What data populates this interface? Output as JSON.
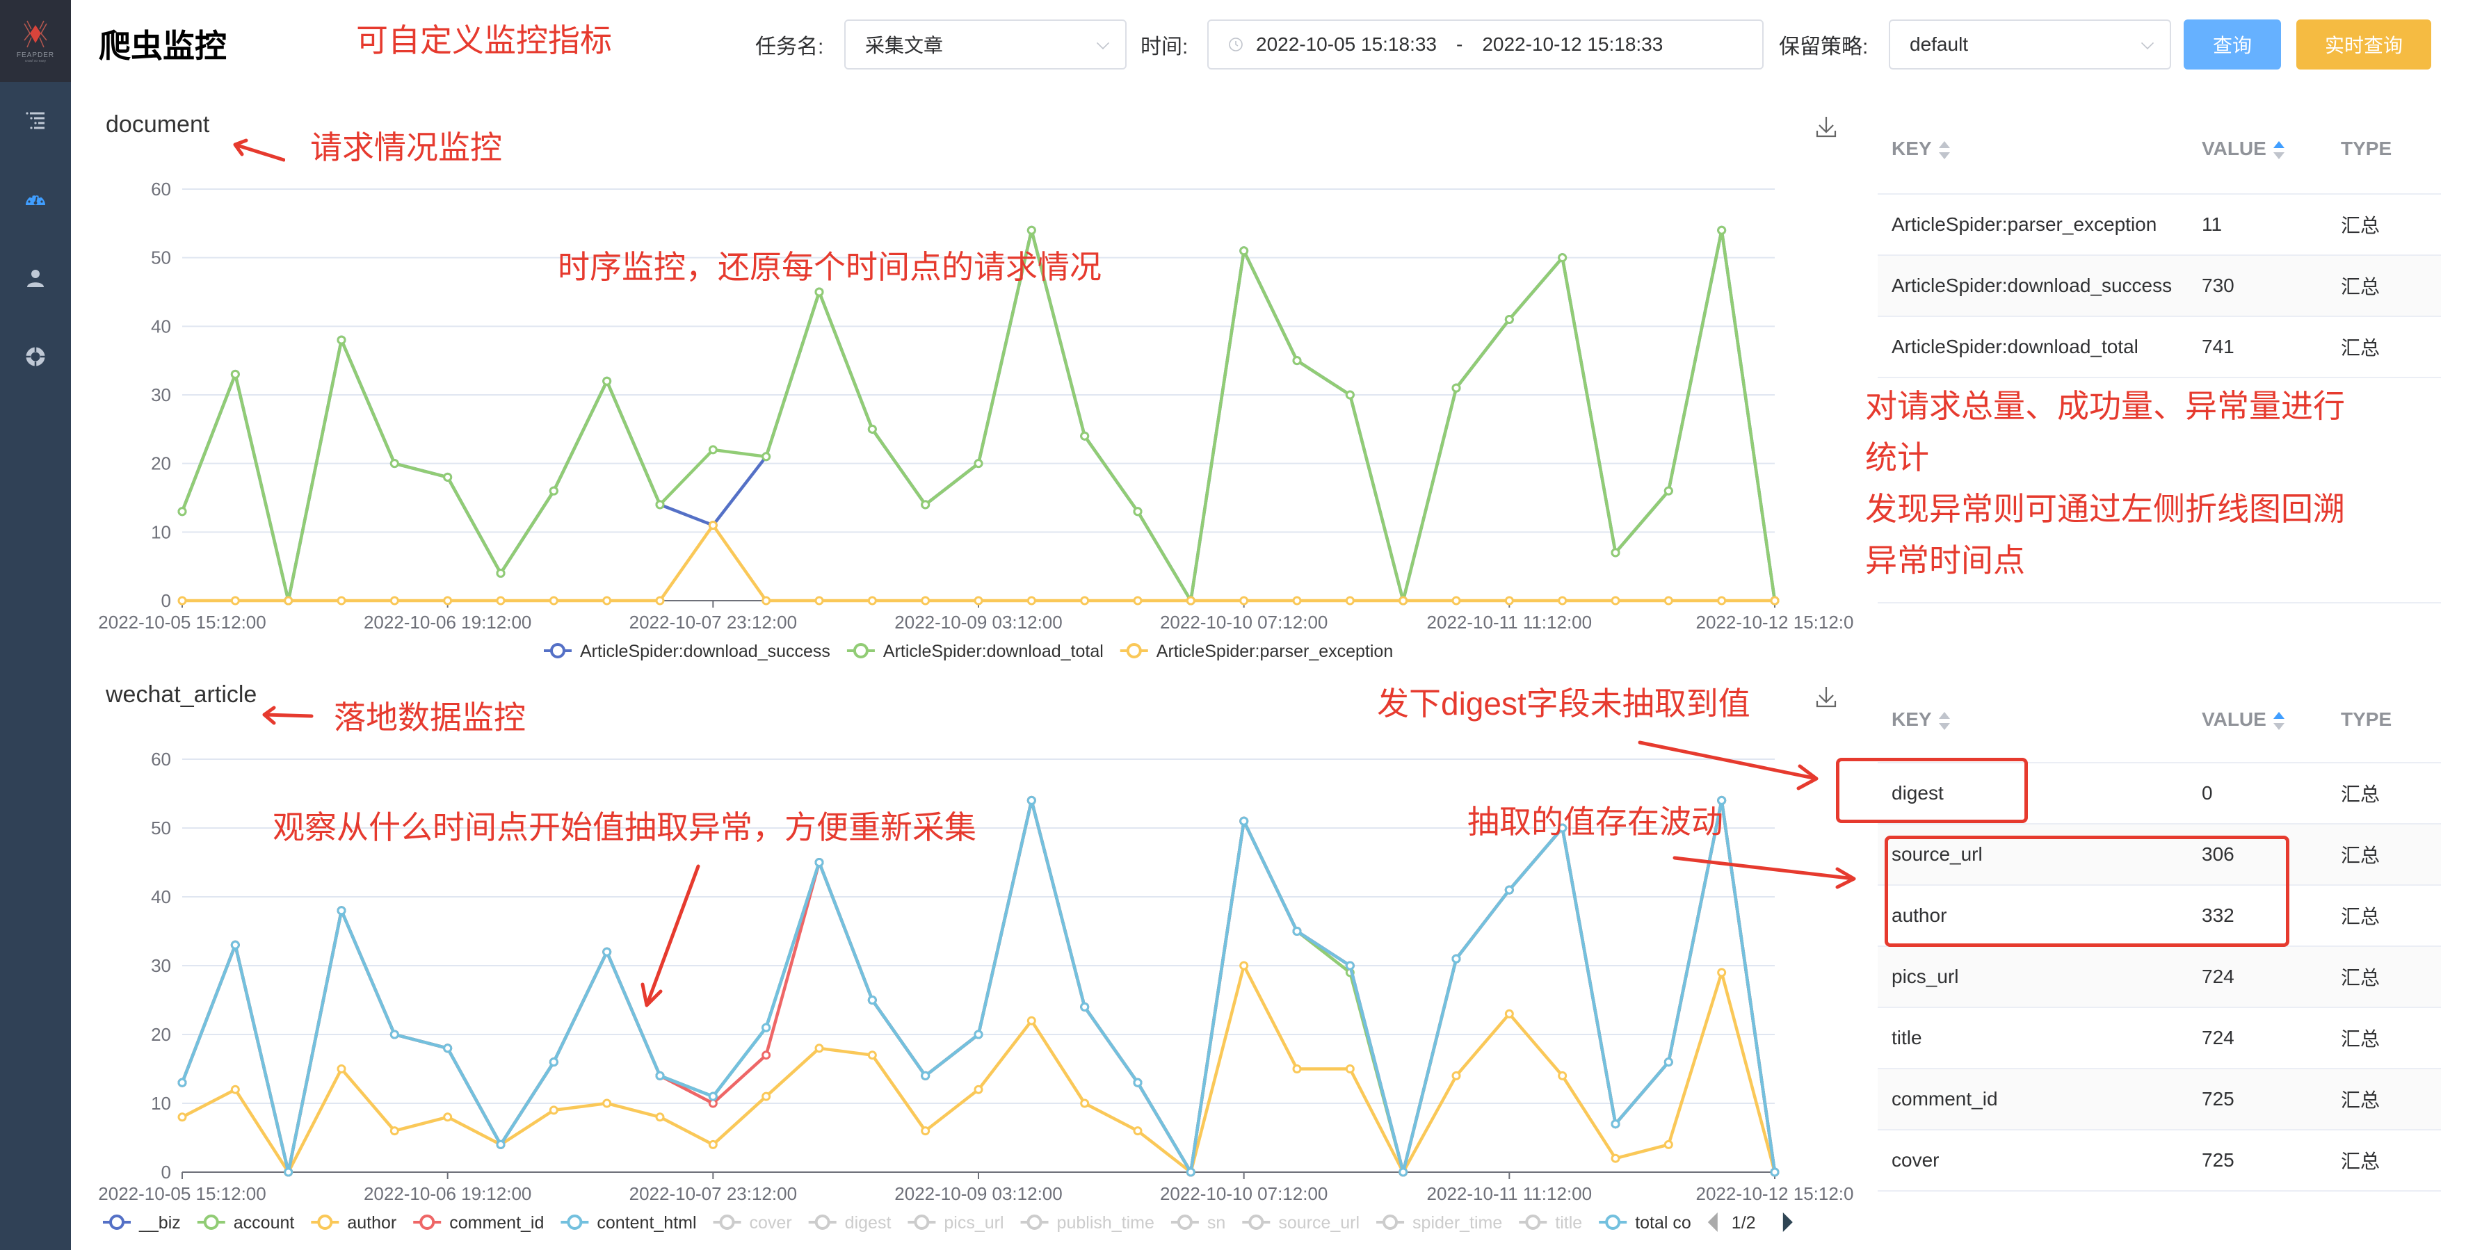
{
  "app": {
    "title": "爬虫监控",
    "logo_text": "FEAPDER",
    "logo_sub": "crawl so easy"
  },
  "sidebar": {
    "items": [
      {
        "icon": "list-tree-icon",
        "active": false
      },
      {
        "icon": "dashboard-gauge-icon",
        "active": true
      },
      {
        "icon": "user-icon",
        "active": false
      },
      {
        "icon": "lifebuoy-icon",
        "active": false
      }
    ]
  },
  "filters": {
    "task_label": "任务名:",
    "task_value": "采集文章",
    "time_label": "时间:",
    "time_start": "2022-10-05 15:18:33",
    "time_sep": "-",
    "time_end": "2022-10-12 15:18:33",
    "retention_label": "保留策略:",
    "retention_value": "default",
    "query_button": "查询",
    "realtime_button": "实时查询"
  },
  "colors": {
    "primary_button": "#66b1ff",
    "realtime_button": "#f5bb42",
    "annotation": "#e63a2e"
  },
  "annotations": {
    "custom_metrics": "可自定义监控指标",
    "request_monitor": "请求情况监控",
    "timeseries": "时序监控，还原每个时间点的请求情况",
    "stats_line1": "对请求总量、成功量、异常量进行",
    "stats_line2": "统计",
    "stats_line3": "发现异常则可通过左侧折线图回溯",
    "stats_line4": "异常时间点",
    "landing_monitor": "落地数据监控",
    "digest_missing": "发下digest字段未抽取到值",
    "observe": "观察从什么时间点开始值抽取异常，方便重新采集",
    "fluctuation": "抽取的值存在波动"
  },
  "tables": [
    {
      "headers": {
        "key": "KEY",
        "value": "VALUE",
        "type": "TYPE"
      },
      "rows": [
        {
          "key": "ArticleSpider:parser_exception",
          "value": "11",
          "type": "汇总"
        },
        {
          "key": "ArticleSpider:download_success",
          "value": "730",
          "type": "汇总"
        },
        {
          "key": "ArticleSpider:download_total",
          "value": "741",
          "type": "汇总"
        }
      ]
    },
    {
      "headers": {
        "key": "KEY",
        "value": "VALUE",
        "type": "TYPE"
      },
      "rows": [
        {
          "key": "digest",
          "value": "0",
          "type": "汇总"
        },
        {
          "key": "source_url",
          "value": "306",
          "type": "汇总"
        },
        {
          "key": "author",
          "value": "332",
          "type": "汇总"
        },
        {
          "key": "pics_url",
          "value": "724",
          "type": "汇总"
        },
        {
          "key": "title",
          "value": "724",
          "type": "汇总"
        },
        {
          "key": "comment_id",
          "value": "725",
          "type": "汇总"
        },
        {
          "key": "cover",
          "value": "725",
          "type": "汇总"
        }
      ]
    }
  ],
  "chart_data": [
    {
      "type": "line",
      "title": "document",
      "ylim": [
        0,
        60
      ],
      "yticks": [
        0,
        10,
        20,
        30,
        40,
        50,
        60
      ],
      "grid": true,
      "legend": "bottom-center",
      "xtick_labels": [
        "2022-10-05 15:12:00",
        "2022-10-06 19:12:00",
        "2022-10-07 23:12:00",
        "2022-10-09 03:12:00",
        "2022-10-10 07:12:00",
        "2022-10-11 11:12:00",
        "2022-10-12 15:12:0"
      ],
      "xtick_every": 5,
      "n_points": 31,
      "series": [
        {
          "name": "ArticleSpider:download_success",
          "color": "#5470c6",
          "visible": true,
          "values": [
            13,
            33,
            0,
            38,
            20,
            18,
            4,
            16,
            32,
            14,
            11,
            21,
            45,
            25,
            14,
            20,
            54,
            24,
            13,
            0,
            51,
            35,
            30,
            0,
            31,
            41,
            50,
            7,
            16,
            54,
            0
          ]
        },
        {
          "name": "ArticleSpider:download_total",
          "color": "#91cc75",
          "visible": true,
          "values": [
            13,
            33,
            0,
            38,
            20,
            18,
            4,
            16,
            32,
            14,
            22,
            21,
            45,
            25,
            14,
            20,
            54,
            24,
            13,
            0,
            51,
            35,
            30,
            0,
            31,
            41,
            50,
            7,
            16,
            54,
            0
          ]
        },
        {
          "name": "ArticleSpider:parser_exception",
          "color": "#fac858",
          "visible": true,
          "values": [
            0,
            0,
            0,
            0,
            0,
            0,
            0,
            0,
            0,
            0,
            11,
            0,
            0,
            0,
            0,
            0,
            0,
            0,
            0,
            0,
            0,
            0,
            0,
            0,
            0,
            0,
            0,
            0,
            0,
            0,
            0
          ]
        }
      ]
    },
    {
      "type": "line",
      "title": "wechat_article",
      "ylim": [
        0,
        60
      ],
      "yticks": [
        0,
        10,
        20,
        30,
        40,
        50,
        60
      ],
      "grid": true,
      "legend": "bottom-left",
      "legend_page": "1/2",
      "xtick_labels": [
        "2022-10-05 15:12:00",
        "2022-10-06 19:12:00",
        "2022-10-07 23:12:00",
        "2022-10-09 03:12:00",
        "2022-10-10 07:12:00",
        "2022-10-11 11:12:00",
        "2022-10-12 15:12:0"
      ],
      "xtick_every": 5,
      "n_points": 31,
      "series": [
        {
          "name": "__biz",
          "color": "#5470c6",
          "visible": true,
          "values": [
            13,
            33,
            0,
            38,
            20,
            18,
            4,
            16,
            32,
            14,
            11,
            21,
            45,
            25,
            14,
            20,
            54,
            24,
            13,
            0,
            51,
            35,
            30,
            0,
            31,
            41,
            50,
            7,
            16,
            54,
            0
          ]
        },
        {
          "name": "account",
          "color": "#91cc75",
          "visible": true,
          "values": [
            13,
            33,
            0,
            38,
            20,
            18,
            4,
            16,
            32,
            14,
            11,
            21,
            45,
            25,
            14,
            20,
            54,
            24,
            13,
            0,
            51,
            35,
            29,
            0,
            31,
            41,
            50,
            7,
            16,
            54,
            0
          ]
        },
        {
          "name": "author",
          "color": "#fac858",
          "visible": true,
          "values": [
            8,
            12,
            0,
            15,
            6,
            8,
            4,
            9,
            10,
            8,
            4,
            11,
            18,
            17,
            6,
            12,
            22,
            10,
            6,
            0,
            30,
            15,
            15,
            0,
            14,
            23,
            14,
            2,
            4,
            29,
            0
          ]
        },
        {
          "name": "comment_id",
          "color": "#ee6666",
          "visible": true,
          "values": [
            13,
            33,
            0,
            38,
            20,
            18,
            4,
            16,
            32,
            14,
            10,
            17,
            45,
            25,
            14,
            20,
            54,
            24,
            13,
            0,
            51,
            35,
            30,
            0,
            31,
            41,
            50,
            7,
            16,
            54,
            0
          ]
        },
        {
          "name": "content_html",
          "color": "#73c0de",
          "visible": true,
          "values": [
            13,
            33,
            0,
            38,
            20,
            18,
            4,
            16,
            32,
            14,
            11,
            21,
            45,
            25,
            14,
            20,
            54,
            24,
            13,
            0,
            51,
            35,
            30,
            0,
            31,
            41,
            50,
            7,
            16,
            54,
            0
          ]
        },
        {
          "name": "cover",
          "color": "#cccccc",
          "visible": false,
          "values": []
        },
        {
          "name": "digest",
          "color": "#cccccc",
          "visible": false,
          "values": []
        },
        {
          "name": "pics_url",
          "color": "#cccccc",
          "visible": false,
          "values": []
        },
        {
          "name": "publish_time",
          "color": "#cccccc",
          "visible": false,
          "values": []
        },
        {
          "name": "sn",
          "color": "#cccccc",
          "visible": false,
          "values": []
        },
        {
          "name": "source_url",
          "color": "#cccccc",
          "visible": false,
          "values": []
        },
        {
          "name": "spider_time",
          "color": "#cccccc",
          "visible": false,
          "values": []
        },
        {
          "name": "title",
          "color": "#cccccc",
          "visible": false,
          "values": []
        },
        {
          "name": "total co",
          "color": "#73c0de",
          "visible": true,
          "values": []
        }
      ]
    }
  ]
}
